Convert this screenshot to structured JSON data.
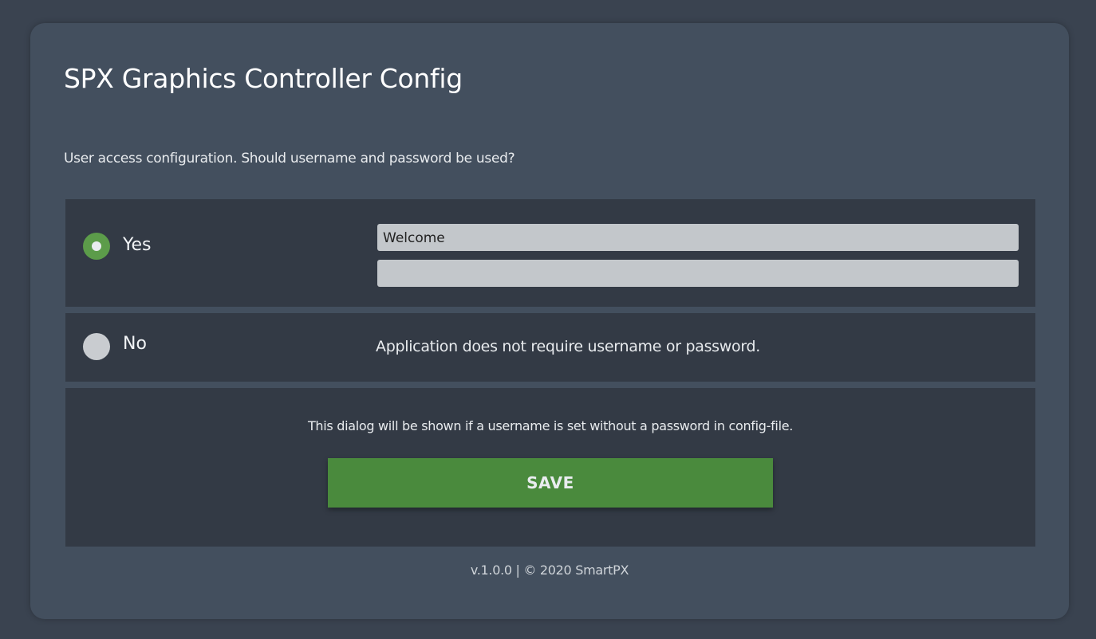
{
  "dialog": {
    "title": "SPX Graphics Controller Config",
    "subtitle": "User access configuration. Should username and password be used?"
  },
  "options": {
    "yes": {
      "label": "Yes",
      "selected": true,
      "username_value": "Welcome",
      "password_value": ""
    },
    "no": {
      "label": "No",
      "selected": false,
      "description": "Application does not require username or password."
    }
  },
  "bottom": {
    "hint": "This dialog will be shown if a username is set without a password in config-file.",
    "save_label": "SAVE"
  },
  "footer": {
    "text": "v.1.0.0 | © 2020 SmartPX"
  },
  "colors": {
    "accent": "#4a8a3d",
    "radio_selected": "#5c9c4a",
    "radio_unselected": "#c9ccd0",
    "background": "#3a4350",
    "card": "#434f5e",
    "panel": "#333a45"
  }
}
